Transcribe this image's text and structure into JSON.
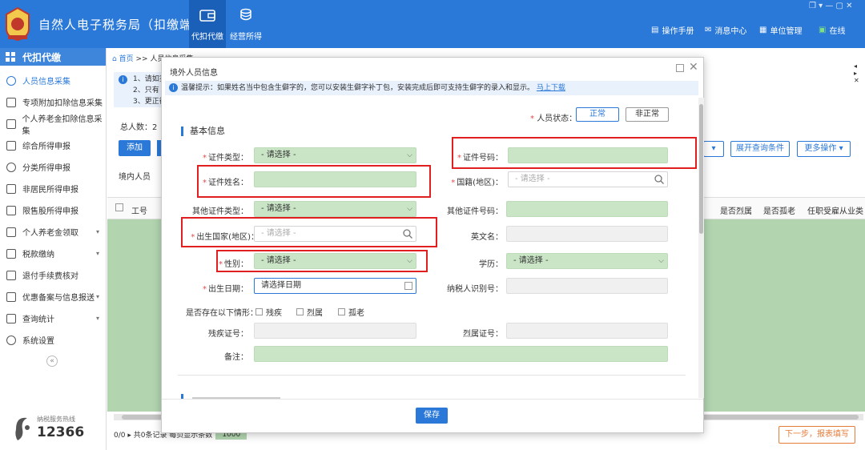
{
  "app": {
    "title": "自然人电子税务局（扣缴端）"
  },
  "nav_tabs": [
    {
      "label": "代扣代缴",
      "icon": "wallet-icon"
    },
    {
      "label": "经营所得",
      "icon": "coins-icon"
    }
  ],
  "top_tools": [
    {
      "label": "操作手册",
      "icon": "book-icon"
    },
    {
      "label": "消息中心",
      "icon": "mail-icon"
    },
    {
      "label": "单位管理",
      "icon": "building-icon"
    },
    {
      "label": "在线",
      "icon": "online-icon"
    }
  ],
  "sidebar": {
    "header": "代扣代缴",
    "items": [
      {
        "label": "人员信息采集",
        "active": true
      },
      {
        "label": "专项附加扣除信息采集"
      },
      {
        "label": "个人养老金扣除信息采集"
      },
      {
        "label": "综合所得申报"
      },
      {
        "label": "分类所得申报"
      },
      {
        "label": "非居民所得申报"
      },
      {
        "label": "限售股所得申报"
      },
      {
        "label": "个人养老金领取",
        "chevron": true
      },
      {
        "label": "税款缴纳",
        "chevron": true
      },
      {
        "label": "退付手续费核对"
      },
      {
        "label": "优惠备案与信息报送",
        "chevron": true
      },
      {
        "label": "查询统计",
        "chevron": true
      },
      {
        "label": "系统设置"
      }
    ],
    "hotline_label": "纳税服务热线",
    "hotline_number": "12366"
  },
  "main": {
    "breadcrumb_home": "首页",
    "breadcrumb_sep": ">>",
    "breadcrumb_current": "人员信息采集",
    "info_lines": [
      "1、请如实",
      "2、只有",
      "3、更正往"
    ],
    "total_label": "总人数：2",
    "add_button": "添加",
    "tab_domestic": "境内人员",
    "expand_query": "展开查询条件",
    "more_ops": "更多操作",
    "columns": [
      "工号",
      "是否烈属",
      "是否孤老",
      "任职受雇从业类"
    ],
    "pager_text": "0/0 ▸ 共0条记录  每页显示条数",
    "page_size": "1000",
    "next_button": "下一步，报表填写"
  },
  "modal": {
    "title": "境外人员信息",
    "tip_text": "温馨提示：如果姓名当中包含生僻字的，您可以安装生僻字补丁包，安装完成后即可支持生僻字的录入和显示。",
    "tip_link": "马上下载",
    "status_label": "人员状态：",
    "status_normal": "正常",
    "status_abnormal": "非正常",
    "section_title": "基本信息",
    "fields": {
      "id_type_label": "证件类型：",
      "id_type_value": "- 请选择 -",
      "id_number_label": "证件号码：",
      "id_name_label": "证件姓名：",
      "nationality_label": "国籍(地区)：",
      "nationality_placeholder": "- 请选择 -",
      "other_id_type_label": "其他证件类型：",
      "other_id_type_value": "- 请选择 -",
      "other_id_number_label": "其他证件号码：",
      "birth_country_label": "出生国家(地区)：",
      "birth_country_placeholder": "- 请选择 -",
      "english_name_label": "英文名：",
      "gender_label": "性别：",
      "gender_value": "- 请选择 -",
      "education_label": "学历：",
      "education_value": "- 请选择 -",
      "birthdate_label": "出生日期：",
      "birthdate_placeholder": "请选择日期",
      "taxpayer_id_label": "纳税人识别号：",
      "situations_label": "是否存在以下情形：",
      "situation_options": [
        "残疾",
        "烈属",
        "孤老"
      ],
      "disability_no_label": "残疾证号：",
      "martyr_no_label": "烈属证号：",
      "remark_label": "备注："
    },
    "save_button": "保存"
  },
  "colors": {
    "brand_blue": "#2a78d8",
    "field_green": "#c9e5c6",
    "highlight_red": "#e02020",
    "next_orange": "#e57c3a"
  }
}
